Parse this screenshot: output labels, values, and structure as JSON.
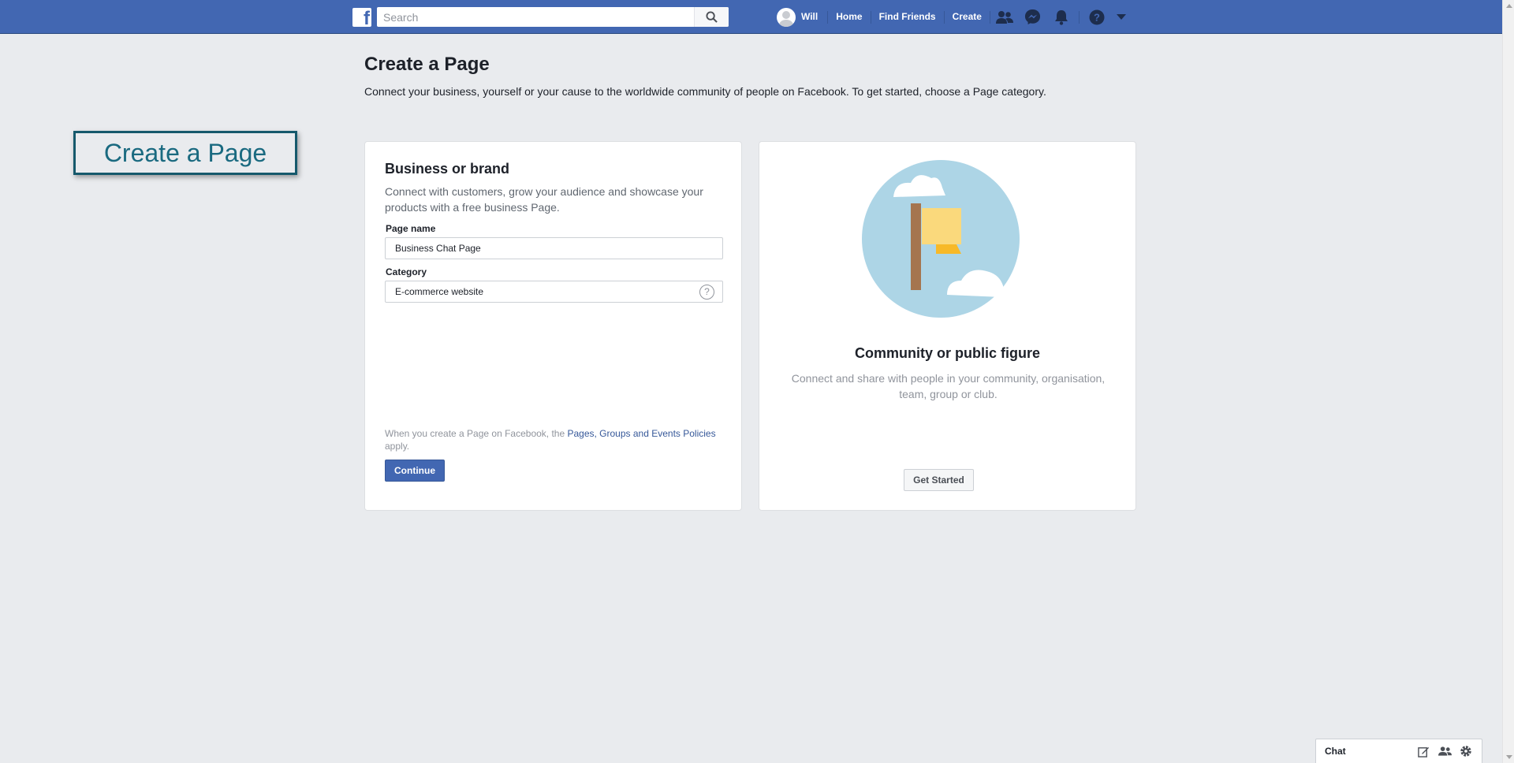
{
  "header": {
    "logo_letter": "f",
    "search": {
      "placeholder": "Search",
      "value": ""
    },
    "user_name": "Will",
    "links": [
      "Home",
      "Find Friends",
      "Create"
    ],
    "icons": [
      "friend-requests-icon",
      "messenger-icon",
      "notifications-icon",
      "help-icon",
      "account-menu-icon"
    ],
    "brand_color": "#4267b2"
  },
  "page": {
    "title": "Create a Page",
    "subtitle": "Connect your business, yourself or your cause to the worldwide community of people on Facebook. To get started, choose a Page category."
  },
  "overlay_label": "Create a Page",
  "business_card": {
    "title": "Business or brand",
    "description": "Connect with customers, grow your audience and showcase your products with a free business Page.",
    "page_name_label": "Page name",
    "page_name_value": "Business Chat Page",
    "category_label": "Category",
    "category_value": "E-commerce website",
    "help_glyph": "?",
    "policy_prefix": "When you create a Page on Facebook, the ",
    "policy_link": "Pages, Groups and Events Policies",
    "policy_suffix": " apply.",
    "continue_label": "Continue"
  },
  "community_card": {
    "title": "Community or public figure",
    "description": "Connect and share with people in your community, organisation, team, group or club.",
    "button_label": "Get Started"
  },
  "chat": {
    "label": "Chat",
    "icons": [
      "new-message-icon",
      "group-icon",
      "settings-icon"
    ]
  }
}
